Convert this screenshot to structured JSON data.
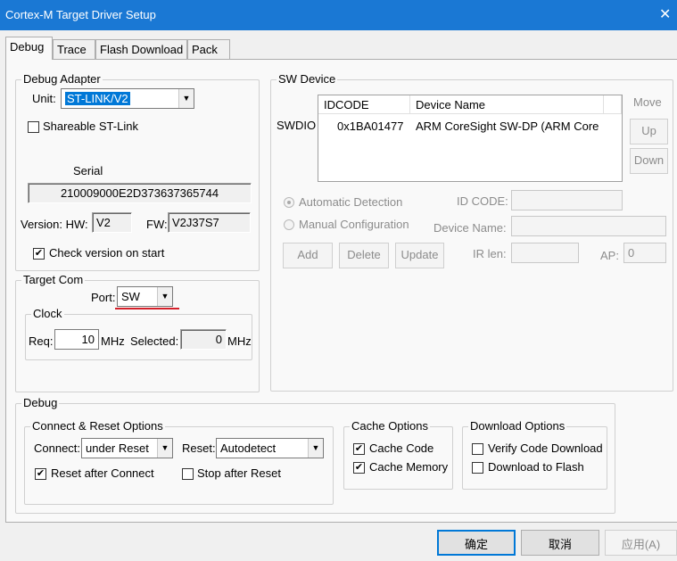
{
  "window": {
    "title": "Cortex-M Target Driver Setup",
    "close_glyph": "✕"
  },
  "tabs": [
    "Debug",
    "Trace",
    "Flash Download",
    "Pack"
  ],
  "debug_adapter": {
    "legend": "Debug Adapter",
    "unit_label": "Unit:",
    "unit_value": "ST-LINK/V2",
    "shareable_label": "Shareable ST-Link",
    "shareable_checked": false,
    "serial_label": "Serial",
    "serial_value": "210009000E2D373637365744",
    "version_label": "Version: HW:",
    "hw_value": "V2",
    "fw_label": "FW:",
    "fw_value": "V2J37S7",
    "check_version_label": "Check version on start",
    "check_version_checked": true
  },
  "target_com": {
    "legend": "Target Com",
    "port_label": "Port:",
    "port_value": "SW",
    "clock": {
      "legend": "Clock",
      "req_label": "Req:",
      "req_value": "10",
      "req_unit": "MHz",
      "selected_label": "Selected:",
      "selected_value": "0",
      "selected_unit": "MHz"
    }
  },
  "sw_device": {
    "legend": "SW Device",
    "columns": [
      "IDCODE",
      "Device Name"
    ],
    "row_label": "SWDIO",
    "rows": [
      {
        "idcode": "0x1BA01477",
        "device_name": "ARM CoreSight SW-DP (ARM Core"
      }
    ],
    "move_label": "Move",
    "up_label": "Up",
    "down_label": "Down",
    "auto_detect_label": "Automatic Detection",
    "manual_config_label": "Manual Configuration",
    "id_code_label": "ID CODE:",
    "device_name_label": "Device Name:",
    "ir_len_label": "IR len:",
    "ap_label": "AP:",
    "ap_value": "0",
    "add_label": "Add",
    "delete_label": "Delete",
    "update_label": "Update"
  },
  "debug": {
    "legend": "Debug",
    "connect_reset": {
      "legend": "Connect & Reset Options",
      "connect_label": "Connect:",
      "connect_value": "under Reset",
      "reset_label": "Reset:",
      "reset_value": "Autodetect",
      "reset_after_connect_label": "Reset after Connect",
      "reset_after_connect_checked": true,
      "stop_after_reset_label": "Stop after Reset",
      "stop_after_reset_checked": false
    },
    "cache": {
      "legend": "Cache Options",
      "cache_code_label": "Cache Code",
      "cache_code_checked": true,
      "cache_memory_label": "Cache Memory",
      "cache_memory_checked": true
    },
    "download": {
      "legend": "Download Options",
      "verify_label": "Verify Code Download",
      "verify_checked": false,
      "download_flash_label": "Download to Flash",
      "download_flash_checked": false
    }
  },
  "footer": {
    "ok_label": "确定",
    "cancel_label": "取消",
    "apply_label": "应用(A)"
  },
  "glyphs": {
    "check": "✔",
    "combo_arrow": "▼"
  },
  "colors": {
    "titlebar": "#1a78d4",
    "selection": "#0078d7",
    "annotation_underline": "#d4202a"
  }
}
